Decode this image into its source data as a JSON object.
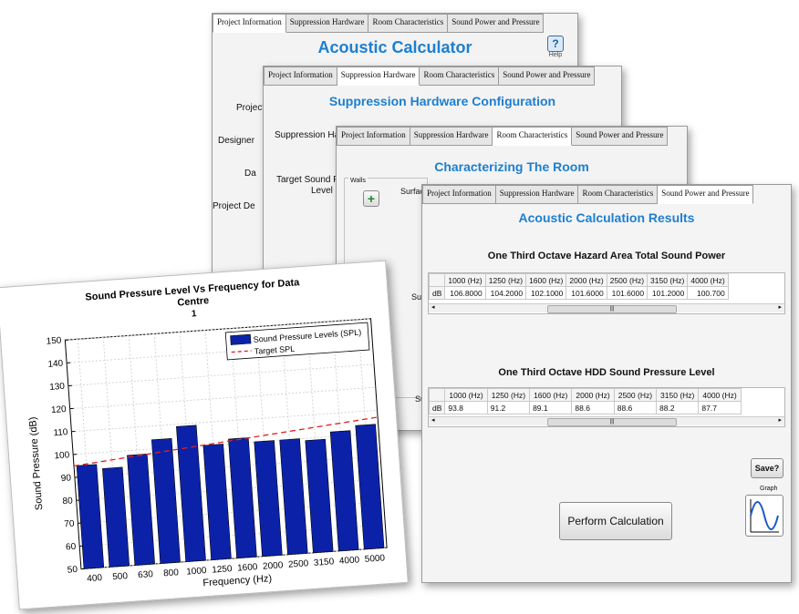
{
  "tabs": [
    "Project Information",
    "Suppression Hardware",
    "Room Characteristics",
    "Sound Power and Pressure"
  ],
  "window1": {
    "title": "Acoustic Calculator",
    "help_label": "Help",
    "labels": [
      "Project",
      "Designer",
      "Da",
      "Project De"
    ]
  },
  "window2": {
    "title": "Suppression Hardware Configuration",
    "labels": [
      "Suppression Hard",
      "Target Sound Pre",
      "Level"
    ]
  },
  "window3": {
    "title": "Characterizing The Room",
    "walls_label": "Walls",
    "add_symbol": "+",
    "surface_labels": [
      "Surfac",
      "Surfa",
      "Surfac"
    ]
  },
  "window4": {
    "title": "Acoustic Calculation Results",
    "table1": {
      "title": "One Third Octave Hazard Area Total Sound Power",
      "headers": [
        "1000 (Hz)",
        "1250 (Hz)",
        "1600 (Hz)",
        "2000 (Hz)",
        "2500 (Hz)",
        "3150 (Hz)",
        "4000 (Hz)"
      ],
      "row_label": "dB",
      "values": [
        "106.8000",
        "104.2000",
        "102.1000",
        "101.6000",
        "101.6000",
        "101.2000",
        "100.700"
      ]
    },
    "table2": {
      "title": "One Third Octave HDD Sound Pressure Level",
      "headers": [
        "1000 (Hz)",
        "1250 (Hz)",
        "1600 (Hz)",
        "2000 (Hz)",
        "2500 (Hz)",
        "3150 (Hz)",
        "4000 (Hz)"
      ],
      "row_label": "dB",
      "values": [
        "93.8",
        "91.2",
        "89.1",
        "88.6",
        "88.6",
        "88.2",
        "87.7"
      ]
    },
    "save_label": "Save?",
    "graph_label": "Graph",
    "perform_label": "Perform Calculation",
    "scroll_thumb": "|||"
  },
  "chart_data": {
    "type": "bar",
    "title": "Sound Pressure Level Vs Frequency for Data Centre",
    "subtitle": "1",
    "xlabel": "Frequency (Hz)",
    "ylabel": "Sound Pressure (dB)",
    "categories": [
      "400",
      "500",
      "630",
      "800",
      "1000",
      "1250",
      "1600",
      "2000",
      "2500",
      "3150",
      "4000",
      "5000"
    ],
    "series": [
      {
        "name": "Sound Pressure Levels (SPL)",
        "values": [
          95,
          93,
          98,
          104,
          109,
          100,
          102,
          100,
          100,
          99,
          102,
          104
        ]
      }
    ],
    "target_line": {
      "name": "Target SPL",
      "start": 95,
      "end": 107
    },
    "ylim": [
      50,
      150
    ],
    "yticks": [
      50,
      60,
      70,
      80,
      90,
      100,
      110,
      120,
      130,
      140,
      150
    ],
    "grid": true,
    "legend_position": "top-right",
    "colors": {
      "bar": "#0b22a8",
      "target": "#e02020"
    }
  }
}
